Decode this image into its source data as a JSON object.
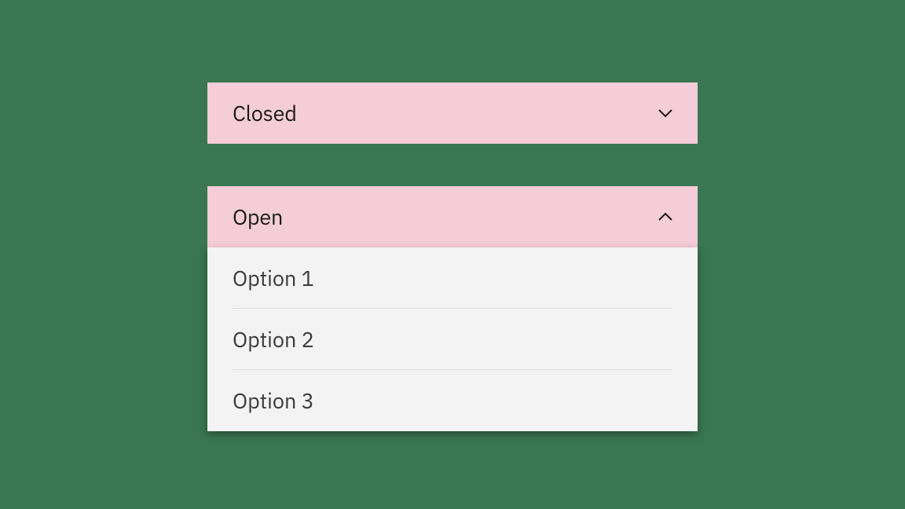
{
  "closed_dropdown": {
    "label": "Closed"
  },
  "open_dropdown": {
    "label": "Open",
    "options": [
      "Option 1",
      "Option 2",
      "Option 3"
    ]
  }
}
